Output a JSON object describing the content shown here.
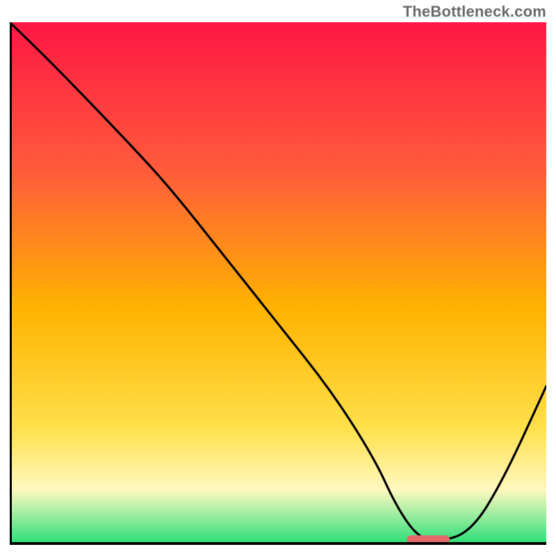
{
  "watermark": "TheBottleneck.com",
  "colors": {
    "gradient_top": "#ff1744",
    "gradient_mid_upper": "#ff5a3c",
    "gradient_mid": "#ffb300",
    "gradient_mid_lower": "#ffe04a",
    "gradient_pale": "#fff8c0",
    "gradient_green": "#2fe07a",
    "curve": "#000000",
    "axis": "#000000",
    "pill": "#e46a6c"
  },
  "chart_data": {
    "type": "line",
    "title": "",
    "xlabel": "",
    "ylabel": "",
    "xlim": [
      0,
      100
    ],
    "ylim": [
      0,
      100
    ],
    "series": [
      {
        "name": "bottleneck-curve",
        "x": [
          0,
          8,
          22,
          30,
          40,
          50,
          60,
          68,
          72,
          76,
          80,
          86,
          92,
          100
        ],
        "y": [
          100,
          92,
          77,
          68,
          55,
          42,
          29,
          16,
          7,
          1,
          0,
          2,
          12,
          30
        ]
      }
    ],
    "annotations": [
      {
        "name": "optimal-marker",
        "x_center": 78,
        "y": 0.5,
        "width": 8
      }
    ]
  }
}
